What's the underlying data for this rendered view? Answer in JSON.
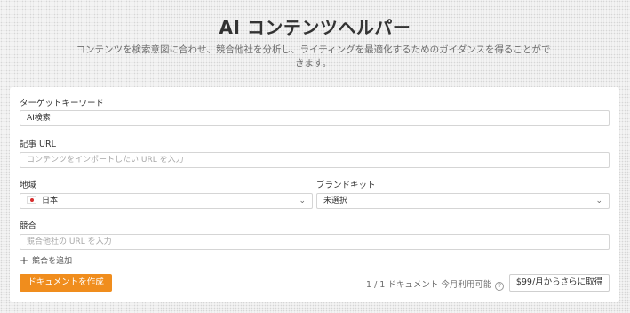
{
  "header": {
    "title": "AI コンテンツヘルパー",
    "subtitle": "コンテンツを検索意図に合わせ、競合他社を分析し、ライティングを最適化するためのガイダンスを得ることができます。"
  },
  "form": {
    "keyword": {
      "label": "ターゲットキーワード",
      "value": "AI検索"
    },
    "article_url": {
      "label": "記事 URL",
      "placeholder": "コンテンツをインポートしたい URL を入力"
    },
    "region": {
      "label": "地域",
      "value": "日本",
      "icon": "japan-flag-icon"
    },
    "brand_kit": {
      "label": "ブランドキット",
      "value": "未選択"
    },
    "competitors": {
      "label": "競合",
      "placeholder": "競合他社の URL を入力",
      "add_label": "競合を追加"
    }
  },
  "footer": {
    "create_button": "ドキュメントを作成",
    "quota_text": "1 / 1 ドキュメント 今月利用可能",
    "upgrade_button": "$99/月からさらに取得"
  },
  "colors": {
    "accent": "#f08d1d",
    "flag_red": "#d72d2d"
  }
}
